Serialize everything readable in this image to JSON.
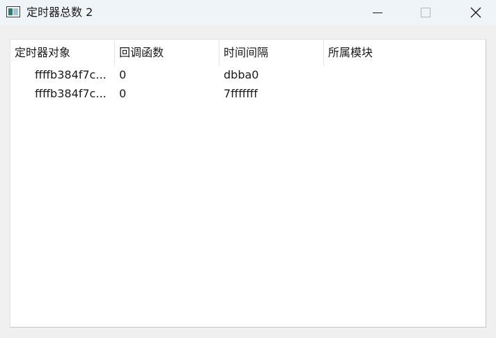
{
  "window": {
    "title": "定时器总数 2",
    "icon": "app-window-icon",
    "controls": {
      "minimize": "minimize-icon",
      "maximize": "maximize-icon",
      "close": "close-icon"
    }
  },
  "table": {
    "columns": [
      "定时器对象",
      "回调函数",
      "时间间隔",
      "所属模块"
    ],
    "rows": [
      [
        "ffffb384f7c...",
        "0",
        "dbba0",
        ""
      ],
      [
        "ffffb384f7c...",
        "0",
        "7fffffff",
        ""
      ]
    ]
  }
}
